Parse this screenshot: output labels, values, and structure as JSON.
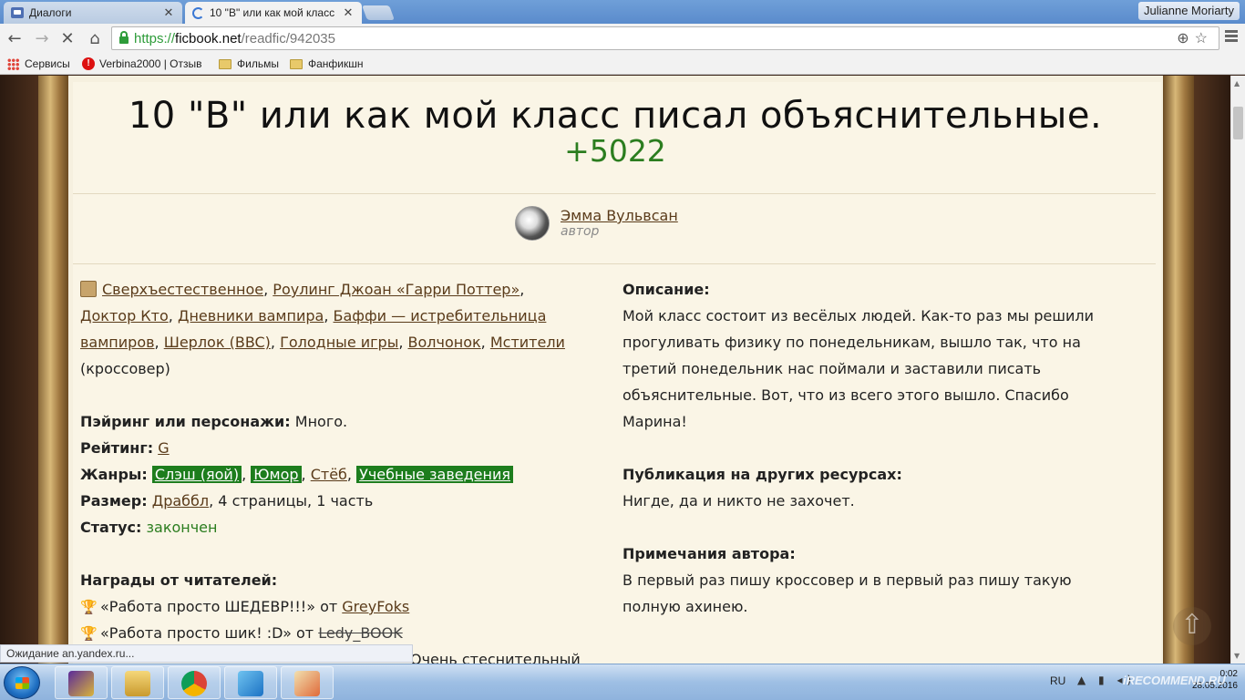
{
  "browser": {
    "tabs": [
      {
        "title": "Диалоги"
      },
      {
        "title": "10 \"В\" или как мой класс"
      }
    ],
    "profile_name": "Julianne Moriarty",
    "url_scheme": "https://",
    "url_host": "ficbook.net",
    "url_path": "/readfic/942035",
    "bookmarks": [
      {
        "label": "Сервисы"
      },
      {
        "label": "Verbina2000 | Отзыв"
      },
      {
        "label": "Фильмы"
      },
      {
        "label": "Фанфикшн"
      }
    ],
    "status_text": "Ожидание an.yandex.ru..."
  },
  "fic": {
    "title": "10 \"В\" или как мой класс писал объяснительные.",
    "likes": "+5022",
    "author_name": "Эмма Вульвсан",
    "author_role": "автор",
    "fandoms": [
      "Сверхъестественное",
      "Роулинг Джоан «Гарри Поттер»",
      "Доктор Кто",
      "Дневники вампира",
      "Баффи — истребительница вампиров",
      "Шерлок (BBC)",
      "Голодные игры",
      "Волчонок",
      "Мстители"
    ],
    "crossover": "(кроссовер)",
    "pairing_label": "Пэйринг или персонажи:",
    "pairing_value": "Много.",
    "rating_label": "Рейтинг:",
    "rating_value": "G",
    "genres_label": "Жанры:",
    "genres": [
      "Слэш (яой)",
      "Юмор",
      "Стёб",
      "Учебные заведения"
    ],
    "size_label": "Размер:",
    "size_link": "Драббл",
    "size_rest": ", 4 страницы, 1 часть",
    "status_label": "Статус:",
    "status_value": "закончен",
    "awards_label": "Награды от читателей:",
    "award1_text": "«Работа просто ШЕДЕВР!!!» от ",
    "award1_user": "GreyFoks",
    "award2_text": "«Работа просто шик! :D» от ",
    "award2_user": "Ledy_BOOK",
    "award3_partial": "Очень стеснительный",
    "description_label": "Описание:",
    "description": "Мой класс состоит из весёлых людей. Как-то раз мы решили прогуливать физику по понедельникам, вышло так, что на третий понедельник нас поймали и заставили писать объяснительные. Вот, что из всего этого вышло. Спасибо Марина!",
    "publication_label": "Публикация на других ресурсах:",
    "publication_value": "Нигде, да и никто не захочет.",
    "notes_label": "Примечания автора:",
    "notes_value": "В первый раз пишу кроссовер и в первый раз пишу такую полную ахинею."
  },
  "taskbar": {
    "lang": "RU",
    "time": "0:02",
    "date": "28.05.2016",
    "watermark": "iRECOMMEND.RU"
  },
  "colors": {
    "like_green": "#2b7d1f",
    "tag_green": "#1d7d1d",
    "link_brown": "#5a3b1a"
  }
}
